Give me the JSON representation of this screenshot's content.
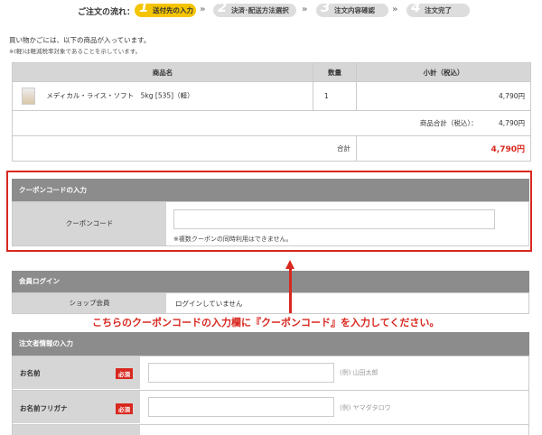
{
  "flow": {
    "label": "ご注文の流れ：",
    "steps": [
      {
        "num": "1",
        "label": "送付先の入力"
      },
      {
        "num": "2",
        "label": "決済･配送方法選択"
      },
      {
        "num": "3",
        "label": "注文内容確認"
      },
      {
        "num": "4",
        "label": "注文完了"
      }
    ],
    "separator": "»"
  },
  "notice": {
    "line1": "買い物かごには、以下の商品が入っています。",
    "line2": "※(軽)は軽減税率対象であることを示しています。"
  },
  "cart": {
    "headers": {
      "product": "商品名",
      "qty": "数量",
      "subtotal": "小計（税込）"
    },
    "item": {
      "name": "メディカル・ライス・ソフト　5kg [535]（軽）",
      "qty": "1",
      "price": "4,790円"
    },
    "items_total_label": "商品合計（税込）：",
    "items_total_value": "4,790円",
    "grand_total_label": "合計",
    "grand_total_value": "4,790円"
  },
  "coupon": {
    "title": "クーポンコードの入力",
    "label": "クーポンコード",
    "value": "",
    "note": "※複数クーポンの同時利用はできません。"
  },
  "login": {
    "title": "会員ログイン",
    "label": "ショップ会員",
    "status": "ログインしていません"
  },
  "annotation": {
    "text": "こちらのクーポンコードの入力欄に『クーポンコード』を入力してください。"
  },
  "orderer": {
    "title": "注文者情報の入力",
    "required": "必須",
    "name_label": "お名前",
    "name_placeholder": "(例) 山田太郎",
    "kana_label": "お名前フリガナ",
    "kana_placeholder": "(例) ヤマダタロウ"
  },
  "colors": {
    "accent": "#f5c400",
    "highlight": "#d8281f",
    "header": "#8c8c8c"
  }
}
